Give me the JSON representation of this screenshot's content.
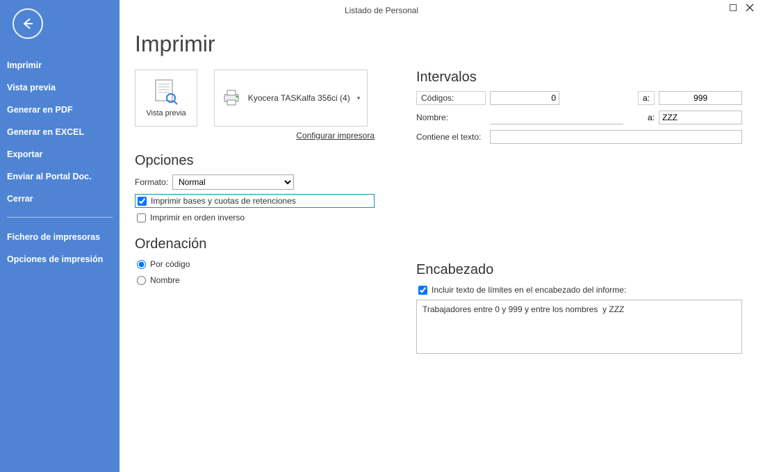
{
  "window": {
    "title": "Listado de Personal"
  },
  "sidebar": {
    "items": [
      "Imprimir",
      "Vista previa",
      "Generar en PDF",
      "Generar en EXCEL",
      "Exportar",
      "Enviar al Portal Doc.",
      "Cerrar"
    ],
    "items2": [
      "Fichero de impresoras",
      "Opciones de impresión"
    ]
  },
  "page": {
    "title": "Imprimir",
    "vista_previa": "Vista previa",
    "printer_name": "Kyocera TASKalfa 356ci (4)",
    "config_link": "Configurar impresora"
  },
  "options": {
    "heading": "Opciones",
    "formato_label": "Formato:",
    "formato_value": "Normal",
    "chk_retenciones": "Imprimir bases y cuotas de retenciones",
    "chk_retenciones_checked": true,
    "chk_inverso": "Imprimir en orden inverso",
    "chk_inverso_checked": false
  },
  "ordenacion": {
    "heading": "Ordenación",
    "por_codigo": "Por código",
    "nombre": "Nombre",
    "selected": "por_codigo"
  },
  "intervalos": {
    "heading": "Intervalos",
    "codigos_label": "Códigos:",
    "codigos_from": "0",
    "codigos_to": "999",
    "a_label": "a:",
    "nombre_label": "Nombre:",
    "nombre_from": "",
    "nombre_to": "ZZZ",
    "contiene_label": "Contiene el texto:",
    "contiene_value": ""
  },
  "encabezado": {
    "heading": "Encabezado",
    "chk_label": "Incluir texto de límites en el encabezado del informe:",
    "chk_checked": true,
    "text": "Trabajadores entre 0 y 999 y entre los nombres  y ZZZ"
  }
}
